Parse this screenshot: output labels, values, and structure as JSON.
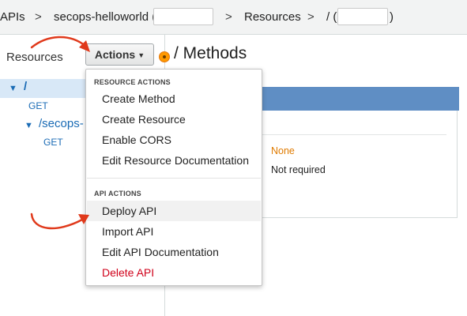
{
  "breadcrumb": {
    "apis": "APIs",
    "sep1": ">",
    "api_name": "secops-helloworld (",
    "sep2": ">",
    "resources": "Resources",
    "sep3": ">",
    "path": "/ (",
    "close_paren": ")"
  },
  "sidebar": {
    "title": "Resources",
    "actions_label": "Actions",
    "tree": {
      "root_path": "/",
      "root_method": "GET",
      "child_path": "/secops-",
      "child_method": "GET"
    }
  },
  "main": {
    "title": "/ Methods",
    "authorization_value": "None",
    "api_key_value": "Not required"
  },
  "menu": {
    "resource_actions_header": "RESOURCE ACTIONS",
    "resource_actions": [
      "Create Method",
      "Create Resource",
      "Enable CORS",
      "Edit Resource Documentation"
    ],
    "api_actions_header": "API ACTIONS",
    "api_actions": [
      "Deploy API",
      "Import API",
      "Edit API Documentation",
      "Delete API"
    ]
  },
  "colors": {
    "tree_link": "#1a6bb5",
    "panel_header": "#5f8ec4",
    "authorization_value": "#e07b00",
    "delete_action": "#d0021b",
    "annotation_arrow": "#e0391b"
  },
  "icons": {
    "actions_dropdown": "caret-down-icon",
    "tree_expand": "caret-down-icon",
    "help": "info-dot-icon",
    "annotations": "red-curved-arrow-icon"
  }
}
